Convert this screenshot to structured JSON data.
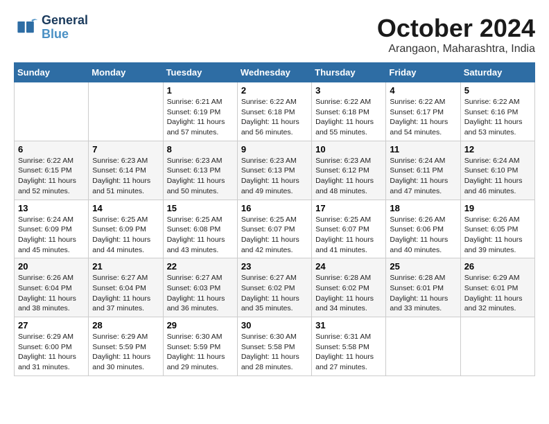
{
  "header": {
    "logo_line1": "General",
    "logo_line2": "Blue",
    "month": "October 2024",
    "location": "Arangaon, Maharashtra, India"
  },
  "weekdays": [
    "Sunday",
    "Monday",
    "Tuesday",
    "Wednesday",
    "Thursday",
    "Friday",
    "Saturday"
  ],
  "weeks": [
    [
      {
        "day": null
      },
      {
        "day": null
      },
      {
        "day": "1",
        "sunrise": "6:21 AM",
        "sunset": "6:19 PM",
        "daylight": "11 hours and 57 minutes."
      },
      {
        "day": "2",
        "sunrise": "6:22 AM",
        "sunset": "6:18 PM",
        "daylight": "11 hours and 56 minutes."
      },
      {
        "day": "3",
        "sunrise": "6:22 AM",
        "sunset": "6:18 PM",
        "daylight": "11 hours and 55 minutes."
      },
      {
        "day": "4",
        "sunrise": "6:22 AM",
        "sunset": "6:17 PM",
        "daylight": "11 hours and 54 minutes."
      },
      {
        "day": "5",
        "sunrise": "6:22 AM",
        "sunset": "6:16 PM",
        "daylight": "11 hours and 53 minutes."
      }
    ],
    [
      {
        "day": "6",
        "sunrise": "6:22 AM",
        "sunset": "6:15 PM",
        "daylight": "11 hours and 52 minutes."
      },
      {
        "day": "7",
        "sunrise": "6:23 AM",
        "sunset": "6:14 PM",
        "daylight": "11 hours and 51 minutes."
      },
      {
        "day": "8",
        "sunrise": "6:23 AM",
        "sunset": "6:13 PM",
        "daylight": "11 hours and 50 minutes."
      },
      {
        "day": "9",
        "sunrise": "6:23 AM",
        "sunset": "6:13 PM",
        "daylight": "11 hours and 49 minutes."
      },
      {
        "day": "10",
        "sunrise": "6:23 AM",
        "sunset": "6:12 PM",
        "daylight": "11 hours and 48 minutes."
      },
      {
        "day": "11",
        "sunrise": "6:24 AM",
        "sunset": "6:11 PM",
        "daylight": "11 hours and 47 minutes."
      },
      {
        "day": "12",
        "sunrise": "6:24 AM",
        "sunset": "6:10 PM",
        "daylight": "11 hours and 46 minutes."
      }
    ],
    [
      {
        "day": "13",
        "sunrise": "6:24 AM",
        "sunset": "6:09 PM",
        "daylight": "11 hours and 45 minutes."
      },
      {
        "day": "14",
        "sunrise": "6:25 AM",
        "sunset": "6:09 PM",
        "daylight": "11 hours and 44 minutes."
      },
      {
        "day": "15",
        "sunrise": "6:25 AM",
        "sunset": "6:08 PM",
        "daylight": "11 hours and 43 minutes."
      },
      {
        "day": "16",
        "sunrise": "6:25 AM",
        "sunset": "6:07 PM",
        "daylight": "11 hours and 42 minutes."
      },
      {
        "day": "17",
        "sunrise": "6:25 AM",
        "sunset": "6:07 PM",
        "daylight": "11 hours and 41 minutes."
      },
      {
        "day": "18",
        "sunrise": "6:26 AM",
        "sunset": "6:06 PM",
        "daylight": "11 hours and 40 minutes."
      },
      {
        "day": "19",
        "sunrise": "6:26 AM",
        "sunset": "6:05 PM",
        "daylight": "11 hours and 39 minutes."
      }
    ],
    [
      {
        "day": "20",
        "sunrise": "6:26 AM",
        "sunset": "6:04 PM",
        "daylight": "11 hours and 38 minutes."
      },
      {
        "day": "21",
        "sunrise": "6:27 AM",
        "sunset": "6:04 PM",
        "daylight": "11 hours and 37 minutes."
      },
      {
        "day": "22",
        "sunrise": "6:27 AM",
        "sunset": "6:03 PM",
        "daylight": "11 hours and 36 minutes."
      },
      {
        "day": "23",
        "sunrise": "6:27 AM",
        "sunset": "6:02 PM",
        "daylight": "11 hours and 35 minutes."
      },
      {
        "day": "24",
        "sunrise": "6:28 AM",
        "sunset": "6:02 PM",
        "daylight": "11 hours and 34 minutes."
      },
      {
        "day": "25",
        "sunrise": "6:28 AM",
        "sunset": "6:01 PM",
        "daylight": "11 hours and 33 minutes."
      },
      {
        "day": "26",
        "sunrise": "6:29 AM",
        "sunset": "6:01 PM",
        "daylight": "11 hours and 32 minutes."
      }
    ],
    [
      {
        "day": "27",
        "sunrise": "6:29 AM",
        "sunset": "6:00 PM",
        "daylight": "11 hours and 31 minutes."
      },
      {
        "day": "28",
        "sunrise": "6:29 AM",
        "sunset": "5:59 PM",
        "daylight": "11 hours and 30 minutes."
      },
      {
        "day": "29",
        "sunrise": "6:30 AM",
        "sunset": "5:59 PM",
        "daylight": "11 hours and 29 minutes."
      },
      {
        "day": "30",
        "sunrise": "6:30 AM",
        "sunset": "5:58 PM",
        "daylight": "11 hours and 28 minutes."
      },
      {
        "day": "31",
        "sunrise": "6:31 AM",
        "sunset": "5:58 PM",
        "daylight": "11 hours and 27 minutes."
      },
      {
        "day": null
      },
      {
        "day": null
      }
    ]
  ]
}
